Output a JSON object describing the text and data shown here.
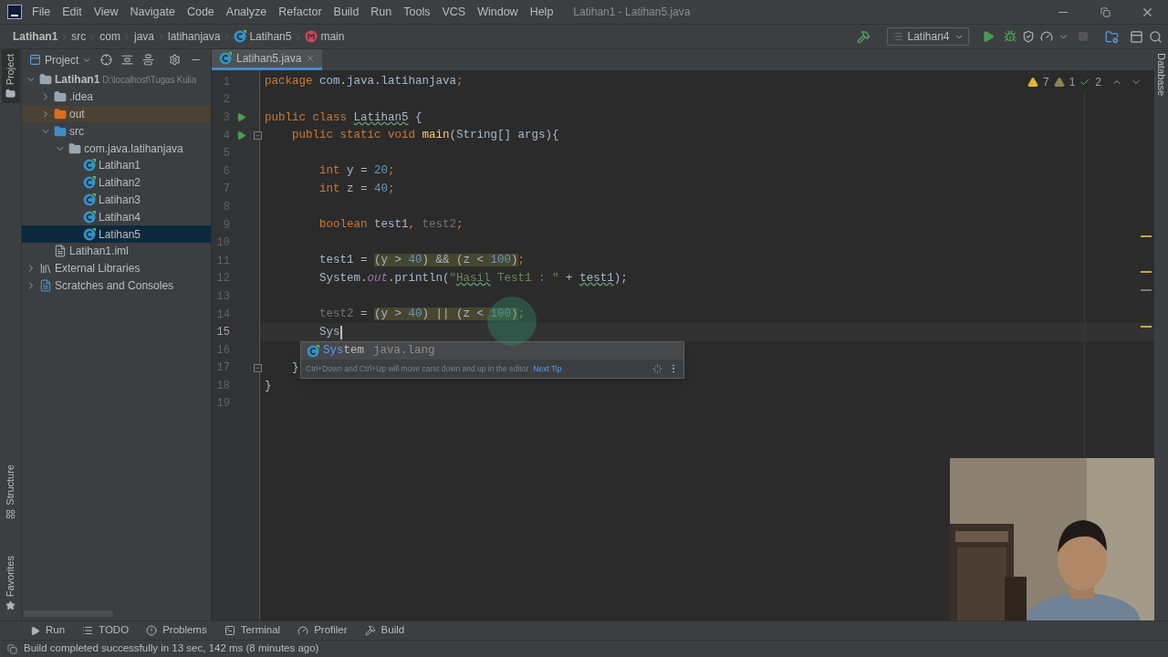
{
  "window": {
    "title": "Latihan1 - Latihan5.java"
  },
  "menu": [
    "File",
    "Edit",
    "View",
    "Navigate",
    "Code",
    "Analyze",
    "Refactor",
    "Build",
    "Run",
    "Tools",
    "VCS",
    "Window",
    "Help"
  ],
  "breadcrumbs": [
    {
      "label": "Latihan1",
      "kind": "project"
    },
    {
      "label": "src",
      "kind": "dir"
    },
    {
      "label": "com",
      "kind": "dir"
    },
    {
      "label": "java",
      "kind": "dir"
    },
    {
      "label": "latihanjava",
      "kind": "dir"
    },
    {
      "label": "Latihan5",
      "kind": "class"
    },
    {
      "label": "main",
      "kind": "method"
    }
  ],
  "run_config": {
    "label": "Latihan4"
  },
  "side_tools_left": [
    {
      "label": "Project",
      "selected": true,
      "kind": "project"
    },
    {
      "label": "Structure",
      "selected": false,
      "kind": "structure"
    },
    {
      "label": "Favorites",
      "selected": false,
      "kind": "favorites"
    }
  ],
  "side_tools_right": [
    {
      "label": "Database"
    }
  ],
  "project_panel": {
    "title": "Project",
    "tree": [
      {
        "label": "Latihan1",
        "path": "D:\\localhost\\Tugas Kulia",
        "kind": "module",
        "expanded": true,
        "selected": false,
        "children": [
          {
            "label": ".idea",
            "kind": "folder",
            "expanded": false,
            "selected": false
          },
          {
            "label": "out",
            "kind": "excluded",
            "expanded": false,
            "selected": false
          },
          {
            "label": "src",
            "kind": "source",
            "expanded": true,
            "selected": false,
            "children": [
              {
                "label": "com.java.latihanjava",
                "kind": "package",
                "expanded": true,
                "selected": false,
                "children": [
                  {
                    "label": "Latihan1",
                    "kind": "class",
                    "selected": false
                  },
                  {
                    "label": "Latihan2",
                    "kind": "class",
                    "selected": false
                  },
                  {
                    "label": "Latihan3",
                    "kind": "class",
                    "selected": false
                  },
                  {
                    "label": "Latihan4",
                    "kind": "class",
                    "selected": false
                  },
                  {
                    "label": "Latihan5",
                    "kind": "class",
                    "selected": true
                  }
                ]
              }
            ]
          },
          {
            "label": "Latihan1.iml",
            "kind": "file",
            "selected": false
          }
        ]
      },
      {
        "label": "External Libraries",
        "kind": "library",
        "expanded": false,
        "selected": false
      },
      {
        "label": "Scratches and Consoles",
        "kind": "scratch",
        "expanded": false,
        "selected": false
      }
    ]
  },
  "editor_tabs": [
    {
      "label": "Latihan5.java",
      "selected": true
    }
  ],
  "inspections": {
    "warnings": "7",
    "weak_warnings": "1",
    "typos": "2"
  },
  "code": [
    {
      "number": "1",
      "current": false,
      "tokens": [
        {
          "kind": "keyword",
          "text": "package "
        },
        {
          "kind": "plain",
          "text": "com.java.latihanjava"
        },
        {
          "kind": "keyword",
          "text": ";"
        }
      ]
    },
    {
      "number": "2",
      "current": false
    },
    {
      "number": "3",
      "current": false,
      "run_marker": true,
      "fold_marker": false,
      "tokens": [
        {
          "kind": "keyword",
          "text": "public class "
        },
        {
          "kind": "typo",
          "text": "Latihan5"
        },
        {
          "kind": "plain",
          "text": " {"
        }
      ]
    },
    {
      "number": "4",
      "current": false,
      "run_marker": true,
      "fold_marker": true,
      "tokens": [
        {
          "kind": "keyword",
          "text": "    public static void "
        },
        {
          "kind": "method",
          "text": "main"
        },
        {
          "kind": "plain",
          "text": "(String[] args){"
        }
      ]
    },
    {
      "number": "5",
      "current": false
    },
    {
      "number": "6",
      "current": false,
      "tokens": [
        {
          "kind": "keyword",
          "text": "        int "
        },
        {
          "kind": "plain",
          "text": "y = "
        },
        {
          "kind": "number",
          "text": "20"
        },
        {
          "kind": "keyword",
          "text": ";"
        }
      ]
    },
    {
      "number": "7",
      "current": false,
      "tokens": [
        {
          "kind": "keyword",
          "text": "        int "
        },
        {
          "kind": "plain",
          "text": "z = "
        },
        {
          "kind": "number",
          "text": "40"
        },
        {
          "kind": "keyword",
          "text": ";"
        }
      ]
    },
    {
      "number": "8",
      "current": false
    },
    {
      "number": "9",
      "current": false,
      "tokens": [
        {
          "kind": "keyword",
          "text": "        boolean "
        },
        {
          "kind": "plain",
          "text": "test1"
        },
        {
          "kind": "keyword",
          "text": ", "
        },
        {
          "kind": "unused",
          "text": "test2"
        },
        {
          "kind": "keyword",
          "text": ";"
        }
      ]
    },
    {
      "number": "10",
      "current": false
    },
    {
      "number": "11",
      "current": false,
      "tokens": [
        {
          "kind": "plain",
          "text": "        test1 = "
        },
        {
          "kind": "highlight",
          "parts": [
            {
              "kind": "plain",
              "text": "(y > "
            },
            {
              "kind": "number",
              "text": "40"
            },
            {
              "kind": "plain",
              "text": ") && (z < "
            },
            {
              "kind": "number",
              "text": "100"
            },
            {
              "kind": "plain",
              "text": ")"
            }
          ]
        },
        {
          "kind": "keyword",
          "text": ";"
        }
      ]
    },
    {
      "number": "12",
      "current": false,
      "tokens": [
        {
          "kind": "plain",
          "text": "        System."
        },
        {
          "kind": "static",
          "text": "out"
        },
        {
          "kind": "plain",
          "text": ".println("
        },
        {
          "kind": "string",
          "text": "\""
        },
        {
          "kind": "string_typo",
          "text": "Hasil"
        },
        {
          "kind": "string",
          "text": " Test1 : \""
        },
        {
          "kind": "plain",
          "text": " + "
        },
        {
          "kind": "typo",
          "text": "test1"
        },
        {
          "kind": "plain",
          "text": ");"
        }
      ]
    },
    {
      "number": "13",
      "current": false
    },
    {
      "number": "14",
      "current": false,
      "tokens": [
        {
          "kind": "unused",
          "text": "        test2"
        },
        {
          "kind": "plain",
          "text": " = "
        },
        {
          "kind": "highlight",
          "parts": [
            {
              "kind": "plain",
              "text": "(y > "
            },
            {
              "kind": "number",
              "text": "40"
            },
            {
              "kind": "plain",
              "text": ") || (z < "
            },
            {
              "kind": "number",
              "text": "100"
            },
            {
              "kind": "plain",
              "text": ")"
            }
          ]
        },
        {
          "kind": "keyword",
          "text": ";"
        }
      ]
    },
    {
      "number": "15",
      "current": true,
      "tokens": [
        {
          "kind": "plain",
          "text": "        Sys"
        }
      ]
    },
    {
      "number": "16",
      "current": false
    },
    {
      "number": "17",
      "current": false,
      "run_marker": false,
      "fold_marker": true,
      "tokens": [
        {
          "kind": "plain",
          "text": "    }"
        }
      ]
    },
    {
      "number": "18",
      "current": false,
      "tokens": [
        {
          "kind": "plain",
          "text": "}"
        }
      ]
    },
    {
      "number": "19",
      "current": false
    }
  ],
  "completion": {
    "items": [
      {
        "match": "Sys",
        "rest": "tem",
        "package": "java.lang"
      }
    ],
    "tip": "Ctrl+Down and Ctrl+Up will move caret down and up in the editor",
    "tip_link": "Next Tip"
  },
  "bottom_tools": [
    {
      "label": "Run",
      "kind": "run"
    },
    {
      "label": "TODO",
      "kind": "todo"
    },
    {
      "label": "Problems",
      "kind": "problems"
    },
    {
      "label": "Terminal",
      "kind": "terminal"
    },
    {
      "label": "Profiler",
      "kind": "profiler"
    },
    {
      "label": "Build",
      "kind": "build"
    }
  ],
  "status_bar": {
    "message": "Build completed successfully in 13 sec, 142 ms (8 minutes ago)"
  }
}
